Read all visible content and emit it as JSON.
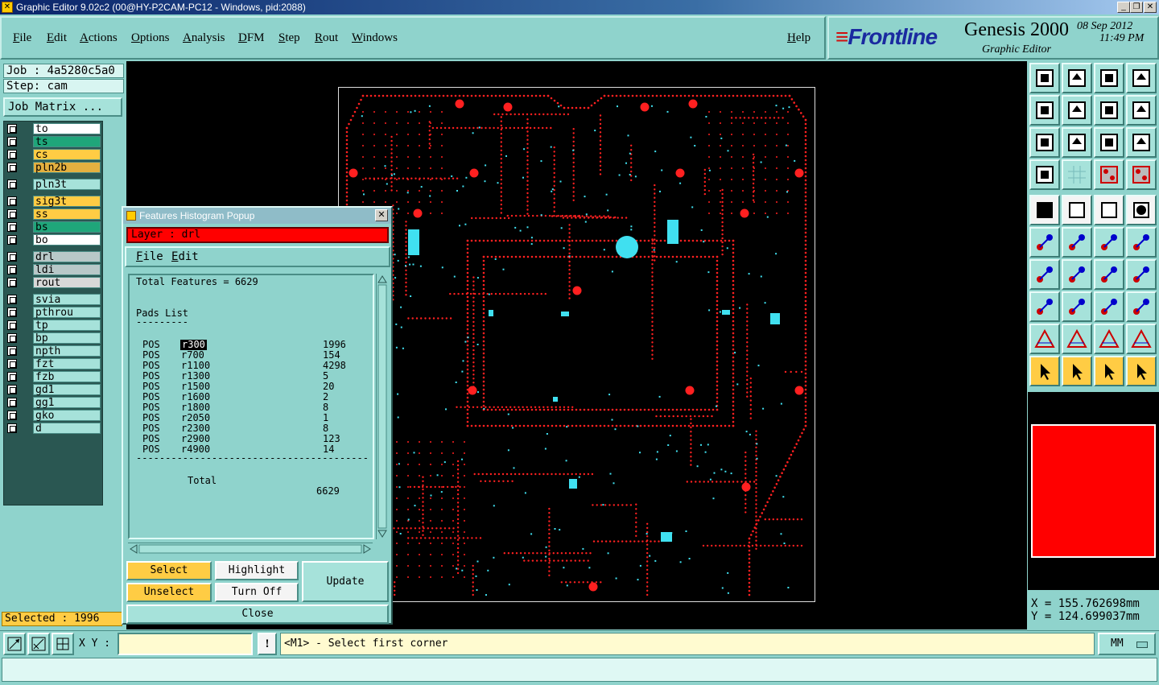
{
  "window": {
    "title": "Graphic Editor 9.02c2 (00@HY-P2CAM-PC12 - Windows, pid:2088)"
  },
  "menu": [
    "File",
    "Edit",
    "Actions",
    "Options",
    "Analysis",
    "DFM",
    "Step",
    "Rout",
    "Windows"
  ],
  "help": "Help",
  "brand": {
    "logo": "Frontline",
    "product": "Genesis 2000",
    "subtitle": "Graphic Editor",
    "date": "08 Sep 2012",
    "time": "11:49 PM"
  },
  "job": {
    "job": "Job : 4a5280c5a0",
    "step": "Step: cam",
    "matrix_button": "Job Matrix ..."
  },
  "layers": [
    {
      "name": "to",
      "color": "#ffffff"
    },
    {
      "name": "ts",
      "color": "#1fa67a"
    },
    {
      "name": "cs",
      "color": "#ffcc44"
    },
    {
      "name": "pln2b",
      "color": "#e3b040"
    },
    {
      "name": "pln3t",
      "color": "#a6e2da"
    },
    {
      "name": "sig3t",
      "color": "#ffcc44"
    },
    {
      "name": "ss",
      "color": "#ffcc44"
    },
    {
      "name": "bs",
      "color": "#1fa67a"
    },
    {
      "name": "bo",
      "color": "#ffffff"
    },
    {
      "name": "drl",
      "color": "#b8c8c8"
    },
    {
      "name": "ldi",
      "color": "#b8c8c8"
    },
    {
      "name": "rout",
      "color": "#d8d8d8"
    },
    {
      "name": "svia",
      "color": "#a6e2da"
    },
    {
      "name": "pthrou",
      "color": "#a6e2da"
    },
    {
      "name": "tp",
      "color": "#a6e2da"
    },
    {
      "name": "bp",
      "color": "#a6e2da"
    },
    {
      "name": "npth",
      "color": "#a6e2da"
    },
    {
      "name": "fzt",
      "color": "#a6e2da"
    },
    {
      "name": "fzb",
      "color": "#a6e2da"
    },
    {
      "name": "gd1",
      "color": "#a6e2da"
    },
    {
      "name": "gg1",
      "color": "#a6e2da"
    },
    {
      "name": "gko",
      "color": "#a6e2da"
    },
    {
      "name": "d",
      "color": "#a6e2da"
    }
  ],
  "selected": "Selected : 1996",
  "popup": {
    "title": "Features Histogram Popup",
    "layer": "Layer :  drl",
    "menu": [
      "File",
      "Edit"
    ],
    "total_features": "Total Features = 6629",
    "list_title": "Pads List",
    "underline": "---------",
    "rows": [
      {
        "pol": "POS",
        "sym": "r300",
        "count": "1996"
      },
      {
        "pol": "POS",
        "sym": "r700",
        "count": "154"
      },
      {
        "pol": "POS",
        "sym": "r1100",
        "count": "4298"
      },
      {
        "pol": "POS",
        "sym": "r1300",
        "count": "5"
      },
      {
        "pol": "POS",
        "sym": "r1500",
        "count": "20"
      },
      {
        "pol": "POS",
        "sym": "r1600",
        "count": "2"
      },
      {
        "pol": "POS",
        "sym": "r1800",
        "count": "8"
      },
      {
        "pol": "POS",
        "sym": "r2050",
        "count": "1"
      },
      {
        "pol": "POS",
        "sym": "r2300",
        "count": "8"
      },
      {
        "pol": "POS",
        "sym": "r2900",
        "count": "123"
      },
      {
        "pol": "POS",
        "sym": "r4900",
        "count": "14"
      }
    ],
    "separator": "----------------------------------------",
    "total_label": "Total",
    "total_value": "6629",
    "buttons": {
      "select": "Select",
      "unselect": "Unselect",
      "highlight": "Highlight",
      "turn_off": "Turn Off",
      "update": "Update",
      "close": "Close"
    }
  },
  "coords": {
    "x": "X = 155.762698mm",
    "y": "Y = 124.699037mm"
  },
  "bottom": {
    "xy_label": "X Y :",
    "xy_value": "",
    "excl": "!",
    "prompt": "<M1> - Select first corner",
    "units": "MM"
  },
  "colors": {
    "board_red": "#ff2020",
    "board_cyan": "#40e0f0",
    "panel": "#8fd3cc"
  }
}
